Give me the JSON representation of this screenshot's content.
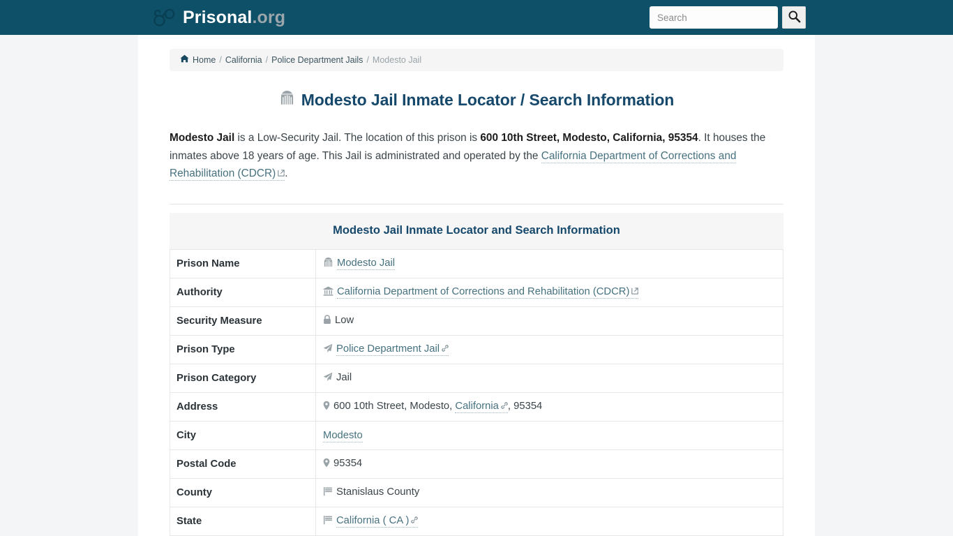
{
  "header": {
    "brand_name": "Prisonal",
    "brand_tld": ".org",
    "brand_icon": "handcuffs-icon",
    "search": {
      "placeholder": "Search",
      "value": "",
      "button_icon": "search-icon"
    }
  },
  "breadcrumb": {
    "home_icon": "home-icon",
    "items": [
      {
        "label": "Home",
        "current": false
      },
      {
        "label": "California",
        "current": false
      },
      {
        "label": "Police Department Jails",
        "current": false
      },
      {
        "label": "Modesto Jail",
        "current": true
      }
    ],
    "separator": "/"
  },
  "main": {
    "title_icon": "jail-archway-icon",
    "title": "Modesto Jail Inmate Locator / Search Information",
    "intro": {
      "prison_name": "Modesto Jail",
      "text_1": " is a Low-Security Jail. The location of this prison is ",
      "address_bold": "600 10th Street, Modesto, California, 95354",
      "text_2": ". It houses the inmates above 18 years of age. This Jail is administrated and operated by the ",
      "authority_link": "California Department of Corrections and Rehabilitation (CDCR)",
      "text_3": "."
    },
    "table": {
      "caption": "Modesto Jail Inmate Locator and Search Information",
      "rows": [
        {
          "label": "Prison Name",
          "icon": "jail-archway-icon",
          "value": "Modesto Jail",
          "link": true,
          "external": false,
          "chain": false
        },
        {
          "label": "Authority",
          "icon": "institution-icon",
          "value": "California Department of Corrections and Rehabilitation (CDCR)",
          "link": true,
          "external": true,
          "chain": false
        },
        {
          "label": "Security Measure",
          "icon": "lock-icon",
          "value": "Low",
          "link": false,
          "external": false,
          "chain": false
        },
        {
          "label": "Prison Type",
          "icon": "paper-plane-icon",
          "value": "Police Department Jail",
          "link": true,
          "external": false,
          "chain": true
        },
        {
          "label": "Prison Category",
          "icon": "paper-plane-icon",
          "value": "Jail",
          "link": false,
          "external": false,
          "chain": false
        },
        {
          "label": "Address",
          "icon": "map-marker-icon",
          "value_prefix": "600 10th Street, Modesto, ",
          "value_link": "California",
          "value_suffix": ", 95354",
          "link": false,
          "external": false,
          "chain": true,
          "composite": true
        },
        {
          "label": "City",
          "icon": "",
          "value": "Modesto",
          "link": true,
          "external": false,
          "chain": false
        },
        {
          "label": "Postal Code",
          "icon": "map-marker-icon",
          "value": "95354",
          "link": false,
          "external": false,
          "chain": false
        },
        {
          "label": "County",
          "icon": "flag-icon",
          "value": "Stanislaus County",
          "link": false,
          "external": false,
          "chain": false
        },
        {
          "label": "State",
          "icon": "flag-icon",
          "value": "California ( CA )",
          "link": true,
          "external": false,
          "chain": true
        }
      ]
    }
  },
  "colors": {
    "header_bg": "#0d5068",
    "title_blue": "#16486b",
    "link_blue": "#46717f",
    "page_bg": "#f4f5f7",
    "caption_bg": "#f6f6f6"
  }
}
